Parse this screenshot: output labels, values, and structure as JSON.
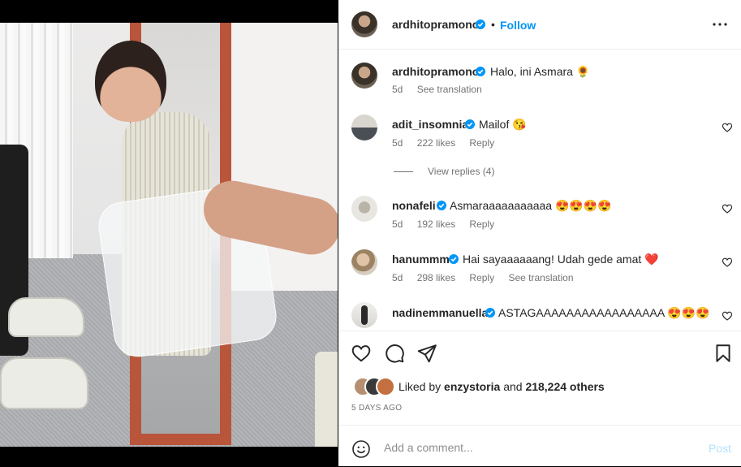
{
  "post": {
    "author": "ardhitopramono",
    "follow_sep": "•",
    "follow_label": "Follow",
    "more_icon": "more-horizontal-icon"
  },
  "caption": {
    "username": "ardhitopramono",
    "text": "Halo, ini Asmara 🌻",
    "age": "5d",
    "see_translation": "See translation"
  },
  "comments": [
    {
      "username": "adit_insomnia",
      "text": "Mailof 😘",
      "age": "5d",
      "likes": "222 likes",
      "reply": "Reply"
    },
    {
      "username": "nonafeli",
      "text": "Asmaraaaaaaaaaaa 😍😍😍😍",
      "age": "5d",
      "likes": "192 likes",
      "reply": "Reply"
    },
    {
      "username": "hanummm",
      "text": "Hai sayaaaaaang! Udah gede amat ❤️",
      "age": "5d",
      "likes": "298 likes",
      "reply": "Reply",
      "see_translation": "See translation"
    },
    {
      "username": "nadinemmanuella",
      "text": "ASTAGAAAAAAAAAAAAAAAAA 😍😍😍"
    }
  ],
  "view_replies": "View replies (4)",
  "likes": {
    "prefix": "Liked by",
    "user": "enzystoria",
    "middle": "and",
    "count": "218,224 others"
  },
  "timestamp": "5 DAYS AGO",
  "comment_box": {
    "placeholder": "Add a comment...",
    "post_label": "Post"
  },
  "colors": {
    "accent": "#0095f6",
    "post_disabled": "#b2dffc",
    "text": "#262626",
    "secondary": "#737373"
  }
}
